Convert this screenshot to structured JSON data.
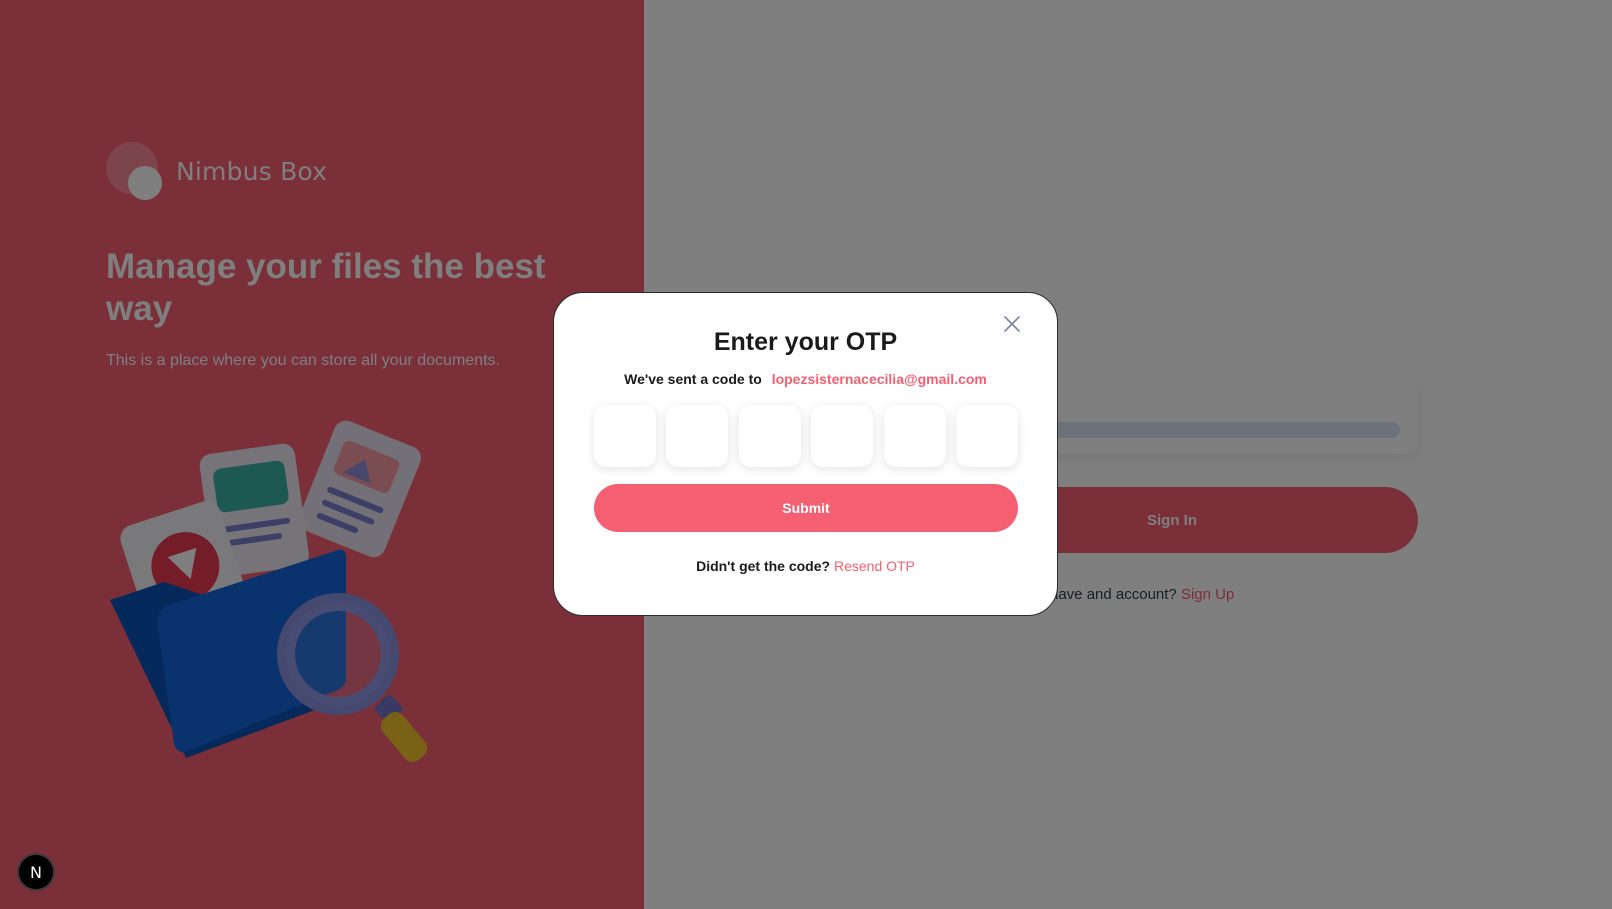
{
  "brand": {
    "name": "Nimbus Box",
    "headline": "Manage your files the best way",
    "subtitle": "This is a place where you can store all your documents."
  },
  "auth_form": {
    "sign_in_label": "Sign In",
    "signup_prompt": "have and account?",
    "signup_link": "Sign Up"
  },
  "otp_modal": {
    "title": "Enter your OTP",
    "sent_prefix": "We've sent a code to",
    "email": "lopezsisternacecilia@gmail.com",
    "digits": [
      "",
      "",
      "",
      "",
      "",
      ""
    ],
    "submit_label": "Submit",
    "resend_prompt": "Didn't get the code?",
    "resend_link": "Resend OTP",
    "close_icon": "close-icon"
  },
  "dev_badge": {
    "label": "N"
  },
  "colors": {
    "accent": "#f55f72",
    "overlay": "rgba(0,0,0,0.5)",
    "folder_blue": "#1565d8"
  }
}
